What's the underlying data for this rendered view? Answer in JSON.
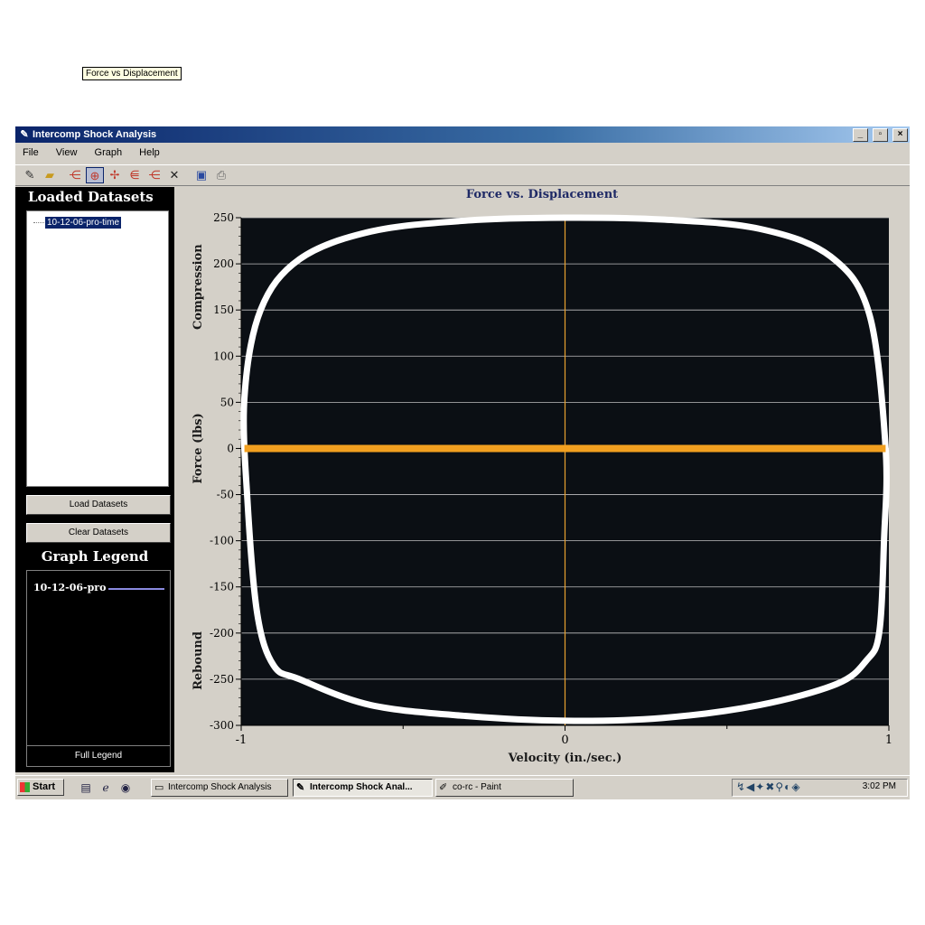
{
  "window": {
    "title": "Intercomp Shock Analysis",
    "controls": [
      "_",
      "▫",
      "×"
    ]
  },
  "menu": [
    "File",
    "View",
    "Graph",
    "Help"
  ],
  "toolbar": {
    "tooltip": "Force vs Displacement"
  },
  "left_panel": {
    "loaded_title": "Loaded Datasets",
    "datasets": [
      "10-12-06-pro-time"
    ],
    "load_button": "Load Datasets",
    "clear_button": "Clear Datasets",
    "legend_title": "Graph Legend",
    "legend_items": [
      {
        "name": "10-12-06-pro",
        "color": "#8a8ae0"
      }
    ],
    "full_legend": "Full Legend"
  },
  "chart_data": {
    "type": "line",
    "title": "Force vs. Displacement",
    "xlabel": "Velocity (in./sec.)",
    "ylabel": "Force (lbs)",
    "ylabel_top": "Compression",
    "ylabel_bottom": "Rebound",
    "xlim": [
      -1,
      1
    ],
    "ylim": [
      -300,
      250
    ],
    "x_ticks": [
      "-1",
      "0",
      "1"
    ],
    "y_ticks": [
      "250",
      "200",
      "150",
      "100",
      "50",
      "0",
      "-50",
      "-100",
      "-150",
      "-200",
      "-250",
      "-300"
    ],
    "grid": true,
    "series": [
      {
        "color": "#ffffff",
        "x": [
          -0.99,
          -0.94,
          -0.82,
          -0.6,
          -0.3,
          0,
          0.3,
          0.6,
          0.82,
          0.94,
          0.99,
          0.985,
          0.97,
          0.93,
          0.84,
          0.6,
          0.3,
          0,
          -0.3,
          -0.6,
          -0.82,
          -0.9,
          -0.95,
          -0.98,
          -0.99
        ],
        "y": [
          55,
          150,
          205,
          235,
          247,
          250,
          248,
          238,
          208,
          145,
          0,
          -100,
          -200,
          -230,
          -255,
          -278,
          -292,
          -295,
          -290,
          -278,
          -250,
          -235,
          -180,
          -60,
          55
        ]
      },
      {
        "color": "#f2a020",
        "x": [
          -0.99,
          0,
          0.99
        ],
        "y": [
          0,
          0,
          0
        ]
      }
    ]
  },
  "taskbar": {
    "start": "Start",
    "tasks": [
      "Intercomp Shock Analysis",
      "Intercomp Shock Anal...",
      "co-rc - Paint"
    ],
    "clock": "3:02 PM"
  }
}
